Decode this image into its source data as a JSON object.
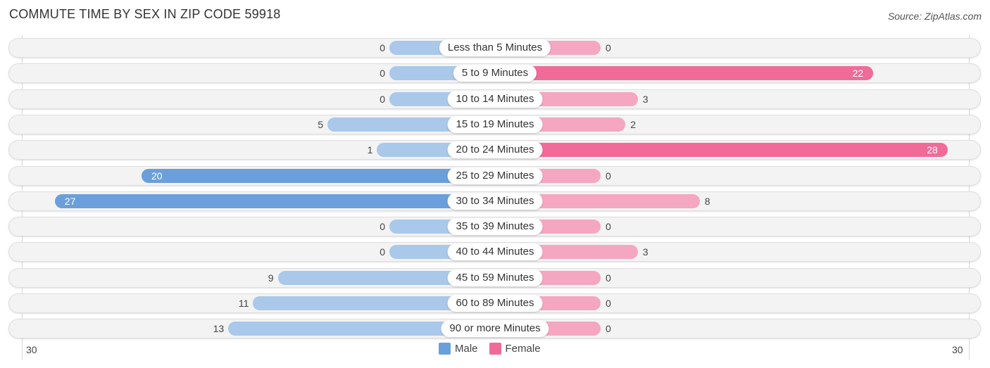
{
  "header": {
    "title": "COMMUTE TIME BY SEX IN ZIP CODE 59918",
    "source": "Source: ZipAtlas.com"
  },
  "colors": {
    "male": "#6a9fdc",
    "male_light": "#a9c8ea",
    "female": "#f06b97",
    "female_light": "#f5a6c0"
  },
  "chart_data": {
    "type": "bar",
    "orientation": "horizontal-diverging",
    "title": "COMMUTE TIME BY SEX IN ZIP CODE 59918",
    "categories": [
      "Less than 5 Minutes",
      "5 to 9 Minutes",
      "10 to 14 Minutes",
      "15 to 19 Minutes",
      "20 to 24 Minutes",
      "25 to 29 Minutes",
      "30 to 34 Minutes",
      "35 to 39 Minutes",
      "40 to 44 Minutes",
      "45 to 59 Minutes",
      "60 to 89 Minutes",
      "90 or more Minutes"
    ],
    "series": [
      {
        "name": "Male",
        "values": [
          0,
          0,
          0,
          5,
          1,
          20,
          27,
          0,
          0,
          9,
          11,
          13
        ]
      },
      {
        "name": "Female",
        "values": [
          0,
          22,
          3,
          2,
          28,
          0,
          8,
          0,
          3,
          0,
          0,
          0
        ]
      }
    ],
    "xlim": [
      -30,
      30
    ],
    "axis_labels": {
      "left": "30",
      "right": "30"
    },
    "legend": {
      "position": "bottom-center",
      "entries": [
        "Male",
        "Female"
      ]
    },
    "xlabel": "",
    "ylabel": ""
  }
}
